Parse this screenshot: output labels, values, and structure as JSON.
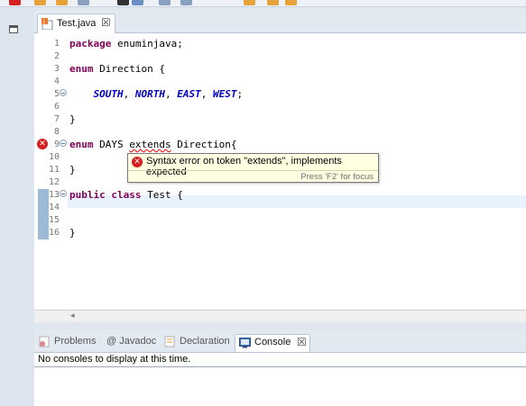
{
  "editor": {
    "tab_label": "Test.java",
    "tab_close": "☒",
    "lines": [
      {
        "n": "1",
        "tokens": [
          {
            "t": "package",
            "c": "kw"
          },
          {
            "t": " enuminjava;",
            "c": ""
          }
        ]
      },
      {
        "n": "2",
        "tokens": []
      },
      {
        "n": "3",
        "tokens": [
          {
            "t": "enum",
            "c": "kw"
          },
          {
            "t": " Direction {",
            "c": ""
          }
        ]
      },
      {
        "n": "4",
        "tokens": []
      },
      {
        "n": "5",
        "fold": true,
        "tokens": [
          {
            "t": "    ",
            "c": ""
          },
          {
            "t": "SOUTH",
            "c": "enumc"
          },
          {
            "t": ", ",
            "c": ""
          },
          {
            "t": "NORTH",
            "c": "enumc"
          },
          {
            "t": ", ",
            "c": ""
          },
          {
            "t": "EAST",
            "c": "enumc"
          },
          {
            "t": ", ",
            "c": ""
          },
          {
            "t": "WEST",
            "c": "enumc"
          },
          {
            "t": ";",
            "c": ""
          }
        ]
      },
      {
        "n": "6",
        "tokens": []
      },
      {
        "n": "7",
        "tokens": [
          {
            "t": "}",
            "c": ""
          }
        ]
      },
      {
        "n": "8",
        "tokens": []
      },
      {
        "n": "9",
        "fold": true,
        "error": true,
        "tokens": [
          {
            "t": "enum",
            "c": "kw"
          },
          {
            "t": " DAYS ",
            "c": ""
          },
          {
            "t": "extends",
            "c": "err"
          },
          {
            "t": " Direction{",
            "c": ""
          }
        ]
      },
      {
        "n": "10",
        "tokens": []
      },
      {
        "n": "11",
        "tokens": [
          {
            "t": "}",
            "c": ""
          }
        ]
      },
      {
        "n": "12",
        "tokens": []
      },
      {
        "n": "13",
        "fold": true,
        "changed": true,
        "tokens": [
          {
            "t": "public",
            "c": "kw"
          },
          {
            "t": " ",
            "c": ""
          },
          {
            "t": "class",
            "c": "kw"
          },
          {
            "t": " Test {",
            "c": ""
          }
        ]
      },
      {
        "n": "14",
        "changed": true,
        "tokens": []
      },
      {
        "n": "15",
        "changed": true,
        "tokens": []
      },
      {
        "n": "16",
        "changed": true,
        "tokens": [
          {
            "t": "}",
            "c": ""
          }
        ]
      }
    ]
  },
  "tooltip": {
    "message": "Syntax error on token \"extends\", implements expected",
    "hint": "Press 'F2' for focus"
  },
  "panel": {
    "tabs": [
      {
        "label": "Problems",
        "icon": "problems-icon",
        "active": false
      },
      {
        "label": "@ Javadoc",
        "icon": "javadoc-icon",
        "active": false
      },
      {
        "label": "Declaration",
        "icon": "declaration-icon",
        "active": false
      },
      {
        "label": "Console",
        "icon": "console-icon",
        "active": true
      }
    ],
    "console_close": "☒",
    "message": "No consoles to display at this time."
  },
  "colors": {
    "keyword": "#7f0055",
    "enum_constant": "#0000c0",
    "error": "#d42020",
    "tooltip_bg": "#ffffe1"
  }
}
